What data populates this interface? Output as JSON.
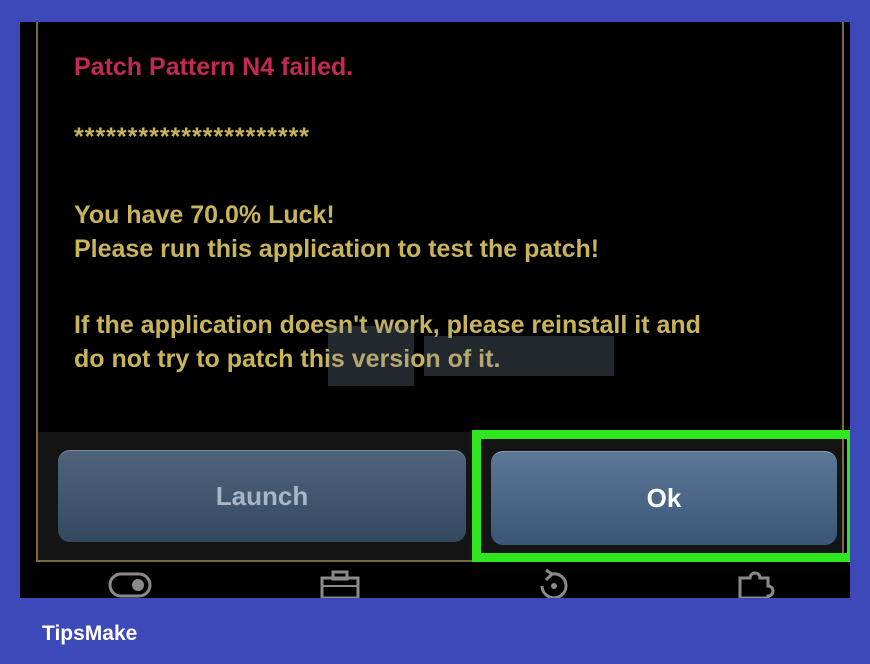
{
  "dialog": {
    "error_line": "Patch Pattern N4 failed.",
    "separator": "**********************",
    "luck_line": "You have 70.0% Luck!",
    "test_line": "Please run this application to test the patch!",
    "warn_line1": "If the application doesn't work, please reinstall it and",
    "warn_line2": "do not try to patch this version of it."
  },
  "buttons": {
    "launch_label": "Launch",
    "ok_label": "Ok"
  },
  "navbar": {
    "icons": [
      "toggle-icon",
      "toolbox-icon",
      "restore-icon",
      "puzzle-icon"
    ]
  },
  "footer": {
    "brand": "TipsMake"
  },
  "colors": {
    "background": "#3d49b8",
    "error_text": "#c22a52",
    "message_text": "#c8b45a",
    "highlight": "#2fe61f",
    "button": "#4b6787"
  }
}
